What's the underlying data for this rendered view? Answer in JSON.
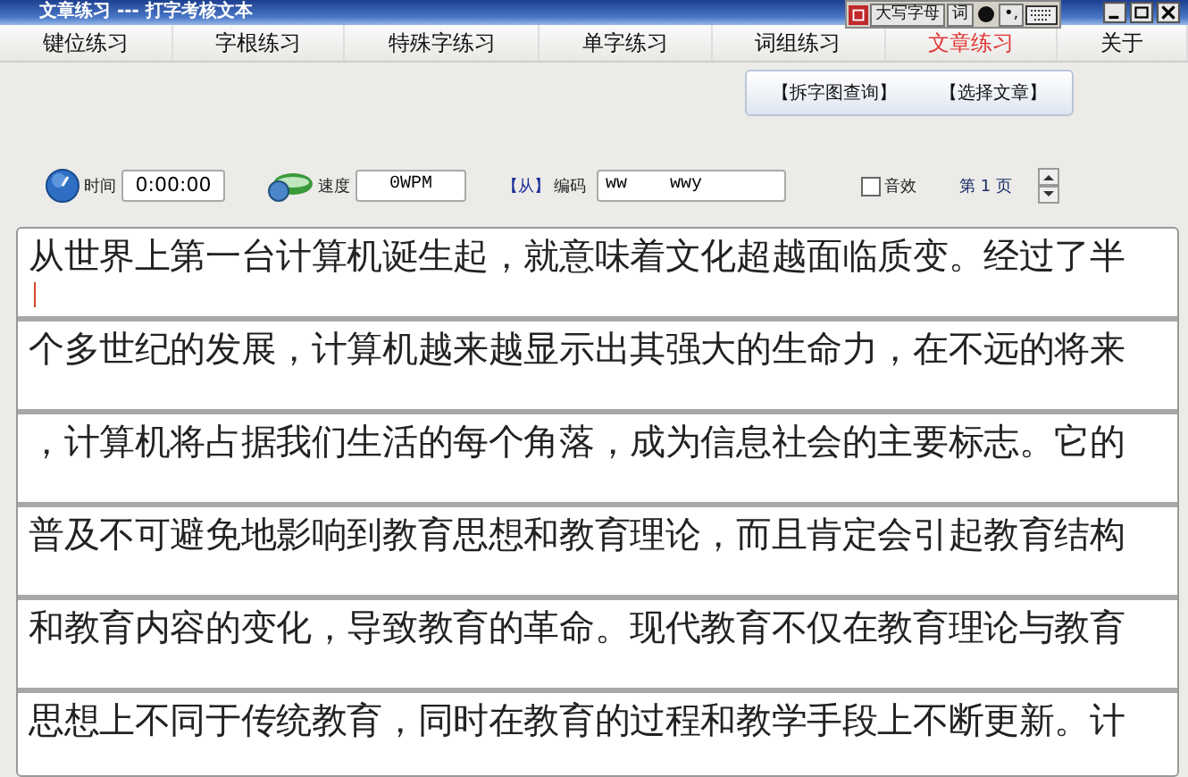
{
  "window": {
    "title": "文章练习 --- 打字考核文本"
  },
  "ime_bar": {
    "caps_label": "大写字母",
    "mode_label": "词",
    "punct_label": "•,"
  },
  "tabs": [
    {
      "label": "键位练习",
      "selected": false
    },
    {
      "label": "字根练习",
      "selected": false
    },
    {
      "label": "特殊字练习",
      "selected": false
    },
    {
      "label": "单字练习",
      "selected": false
    },
    {
      "label": "词组练习",
      "selected": false
    },
    {
      "label": "文章练习",
      "selected": true
    },
    {
      "label": "关于",
      "selected": false
    }
  ],
  "actions": [
    "【拆字图查询】",
    "【选择文章】"
  ],
  "controls": {
    "time_label": "时间",
    "time_value": "0:00:00",
    "speed_label": "速度",
    "speed_value": "0WPM",
    "code_char": "【从】",
    "code_label": "编码",
    "code_value": "ww    wwy",
    "sound_label": "音效",
    "sound_checked": false,
    "page_label": "第 1 页"
  },
  "lines": [
    {
      "text": "从世界上第一台计算机诞生起，就意味着文化超越面临质变。经过了半",
      "cursor": true
    },
    {
      "text": "个多世纪的发展，计算机越来越显示出其强大的生命力，在不远的将来",
      "cursor": false
    },
    {
      "text": "，计算机将占据我们生活的每个角落，成为信息社会的主要标志。它的",
      "cursor": false
    },
    {
      "text": "普及不可避免地影响到教育思想和教育理论，而且肯定会引起教育结构",
      "cursor": false
    },
    {
      "text": "和教育内容的变化，导致教育的革命。现代教育不仅在教育理论与教育",
      "cursor": false
    },
    {
      "text": "思想上不同于传统教育，同时在教育的过程和教学手段上不断更新。计",
      "cursor": false
    }
  ]
}
